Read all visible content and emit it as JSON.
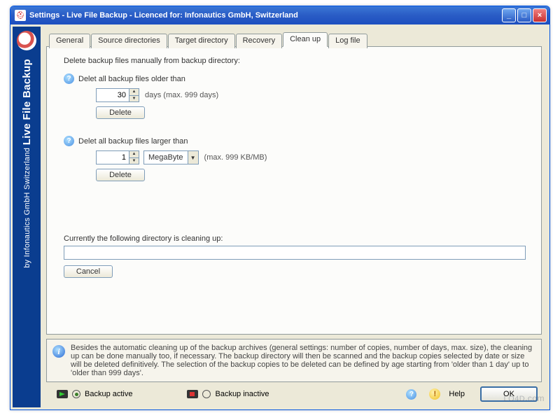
{
  "window": {
    "title": "Settings - Live File Backup - Licenced for: Infonautics GmbH, Switzerland"
  },
  "sidebar": {
    "small_text": "by Infonautics GmbH Switzerland",
    "big_text": "Live File Backup"
  },
  "tabs": [
    "General",
    "Source directories",
    "Target directory",
    "Recovery",
    "Clean up",
    "Log file"
  ],
  "active_tab": "Clean up",
  "cleanup": {
    "heading": "Delete backup files manually from backup directory:",
    "older": {
      "label": "Delet all backup files older than",
      "value": "30",
      "unit_hint": "days (max. 999 days)",
      "button": "Delete"
    },
    "larger": {
      "label": "Delet all backup files larger than",
      "value": "1",
      "unit_selected": "MegaByte",
      "unit_hint": "(max. 999 KB/MB)",
      "button": "Delete"
    },
    "current": {
      "label": "Currently the following directory is cleaning up:",
      "value": "",
      "cancel": "Cancel"
    }
  },
  "info_text": "Besides the automatic cleaning up of the backup archives (general settings: number of copies, number of days, max. size), the cleaning up can be done manually too, if necessary. The backup directory will then be scanned and the backup copies selected by date or size will be deleted definitively. The selection of the backup copies to be deleted can be defined by age starting from 'older than 1 day' up to 'older than 999 days'.",
  "bottom": {
    "active_label": "Backup active",
    "inactive_label": "Backup inactive",
    "help_label": "Help",
    "ok_label": "OK"
  },
  "watermark": "LO4D.com"
}
